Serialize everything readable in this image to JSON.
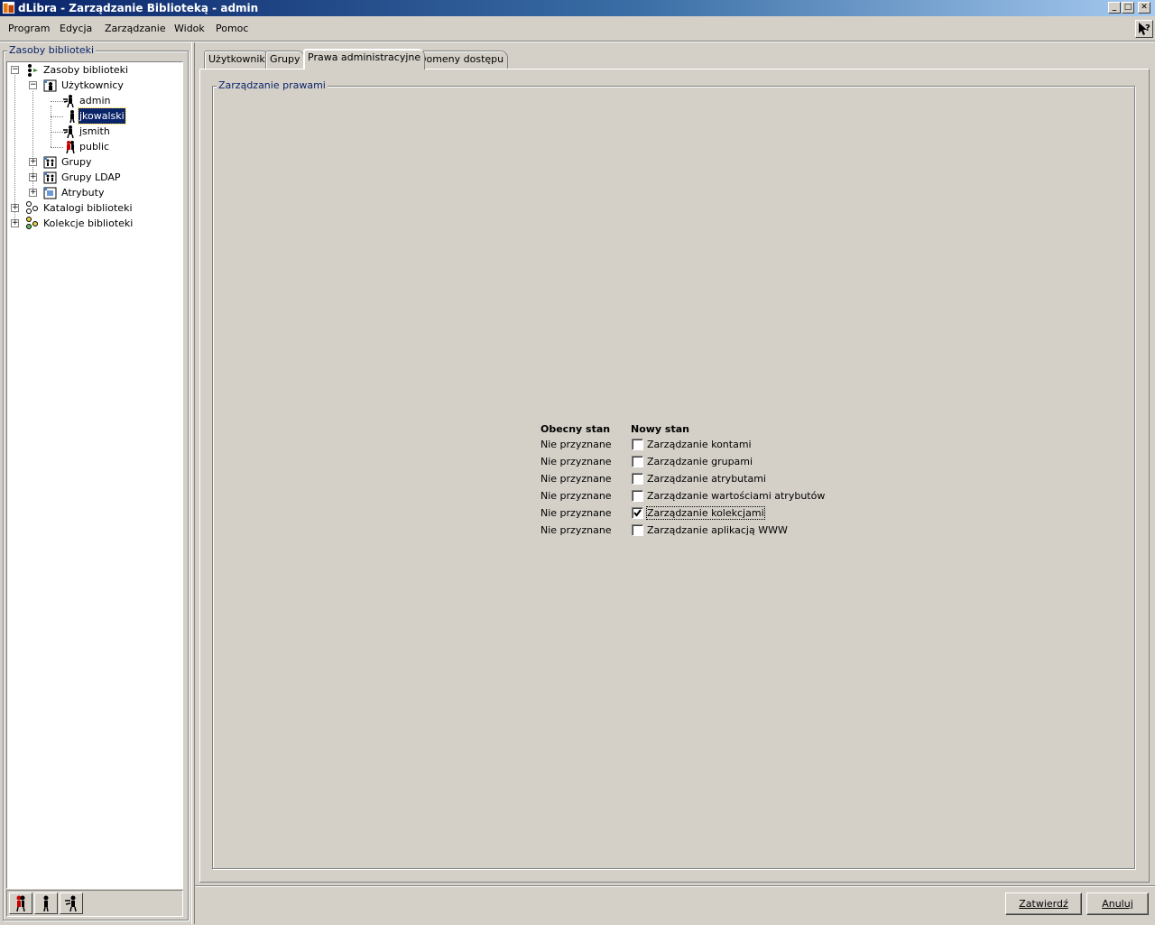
{
  "window": {
    "title": "dLibra - Zarządzanie Biblioteką - admin",
    "controls": {
      "minimize": "_",
      "maximize": "□",
      "close": "✕"
    }
  },
  "menu": [
    {
      "label": "Program"
    },
    {
      "label": "Edycja"
    },
    {
      "label": "Zarządzanie"
    },
    {
      "label": "Widok"
    },
    {
      "label": "Pomoc"
    }
  ],
  "left_panel": {
    "legend": "Zasoby biblioteki",
    "tree": {
      "root": "Zasoby biblioteki",
      "users_node": "Użytkownicy",
      "users": [
        "admin",
        "jkowalski",
        "jsmith",
        "public"
      ],
      "selected_user": "jkowalski",
      "groups": "Grupy",
      "ldap_groups": "Grupy LDAP",
      "attributes": "Atrybuty",
      "catalogs": "Katalogi biblioteki",
      "collections": "Kolekcje biblioteki"
    }
  },
  "tabs": [
    {
      "label": "Użytkownik"
    },
    {
      "label": "Grupy"
    },
    {
      "label": "Prawa administracyjne"
    },
    {
      "label": "Domeny dostępu"
    }
  ],
  "active_tab": "Prawa administracyjne",
  "rights": {
    "legend": "Zarządzanie prawami",
    "current_header": "Obecny stan",
    "new_header": "Nowy stan",
    "rows": [
      {
        "current": "Nie przyznane",
        "label": "Zarządzanie kontami",
        "checked": false
      },
      {
        "current": "Nie przyznane",
        "label": "Zarządzanie grupami",
        "checked": false
      },
      {
        "current": "Nie przyznane",
        "label": "Zarządzanie atrybutami",
        "checked": false
      },
      {
        "current": "Nie przyznane",
        "label": "Zarządzanie wartościami atrybutów",
        "checked": false
      },
      {
        "current": "Nie przyznane",
        "label": "Zarządzanie kolekcjami",
        "checked": true
      },
      {
        "current": "Nie przyznane",
        "label": "Zarządzanie aplikacją WWW",
        "checked": false
      }
    ]
  },
  "buttons": {
    "confirm": "Zatwierdź",
    "cancel": "Anuluj"
  }
}
